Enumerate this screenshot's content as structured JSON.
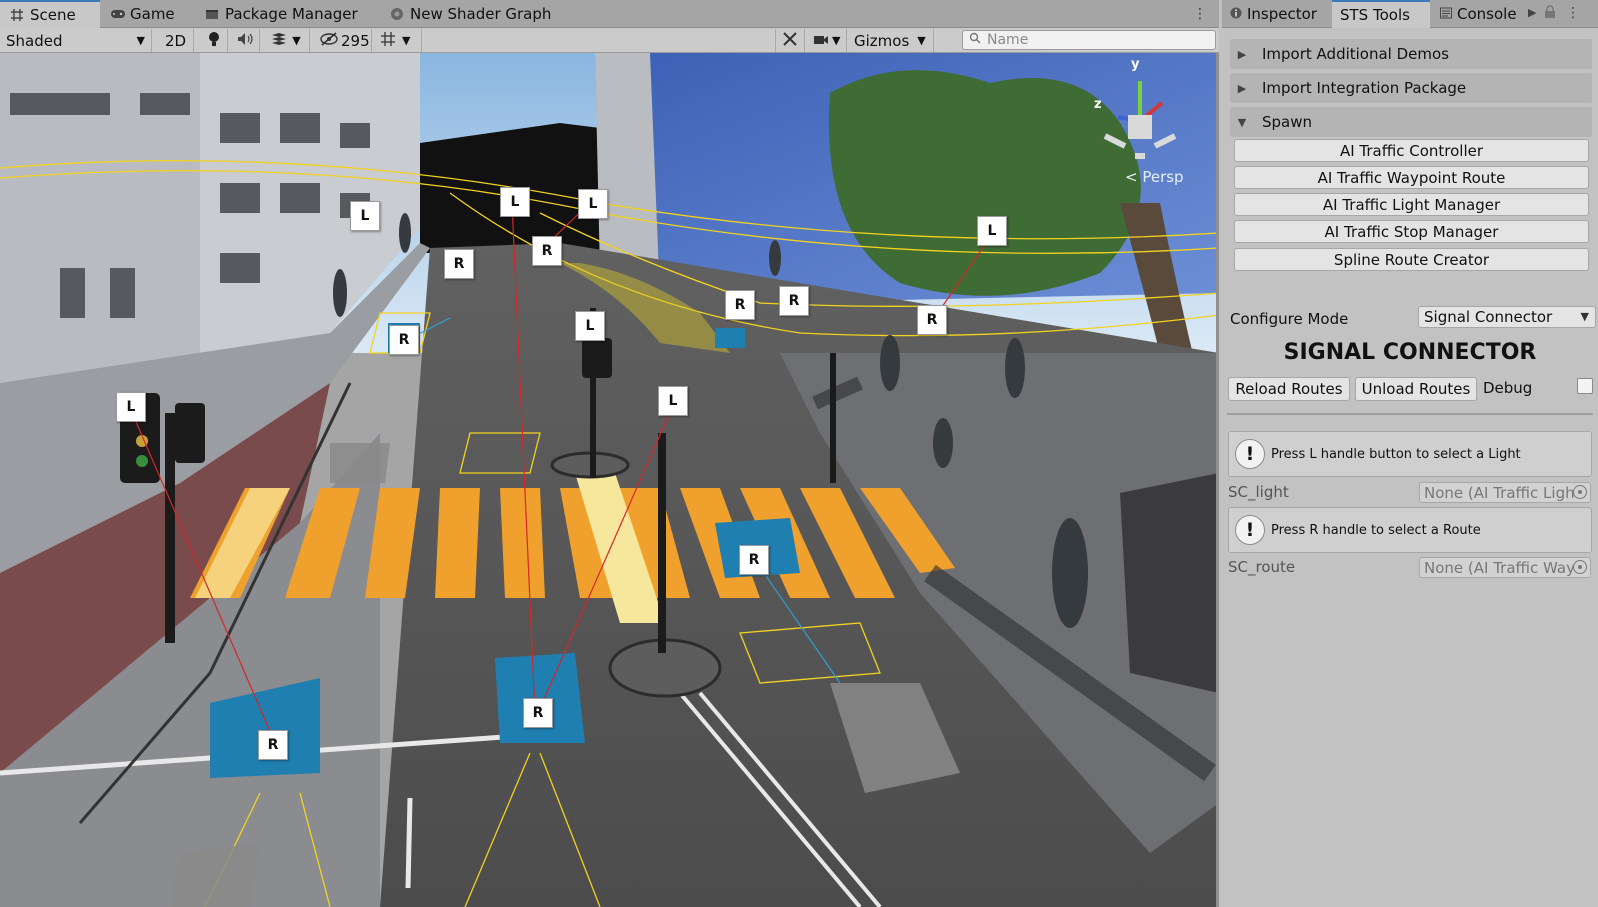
{
  "scene_tabs": [
    {
      "label": "Scene",
      "icon": "grid-icon"
    },
    {
      "label": "Game",
      "icon": "gamepad-icon"
    },
    {
      "label": "Package Manager",
      "icon": "package-icon"
    },
    {
      "label": "New Shader Graph",
      "icon": "shader-graph-icon"
    }
  ],
  "toolbar": {
    "shading_mode": "Shaded",
    "mode_2d": "2D",
    "hidden_count": "295",
    "gizmos": "Gizmos",
    "search_placeholder": "Name"
  },
  "viewport": {
    "persp_label": "< Persp",
    "axis_y": "y",
    "axis_z": "z",
    "handles": [
      {
        "t": "L"
      },
      {
        "t": "L"
      },
      {
        "t": "L"
      },
      {
        "t": "R"
      },
      {
        "t": "R"
      },
      {
        "t": "L"
      },
      {
        "t": "R"
      },
      {
        "t": "L"
      },
      {
        "t": "L"
      },
      {
        "t": "R"
      },
      {
        "t": "R"
      },
      {
        "t": "R"
      },
      {
        "t": "L"
      },
      {
        "t": "L"
      },
      {
        "t": "R"
      },
      {
        "t": "R"
      },
      {
        "t": "R"
      }
    ]
  },
  "right_tabs": [
    {
      "label": "Inspector",
      "icon": "info-icon"
    },
    {
      "label": "STS Tools",
      "icon": ""
    },
    {
      "label": "Console",
      "icon": "console-icon"
    }
  ],
  "sections": {
    "import_demos": "Import Additional Demos",
    "import_integration": "Import Integration Package",
    "spawn": "Spawn"
  },
  "spawn_buttons": [
    "AI Traffic Controller",
    "AI Traffic Waypoint Route",
    "AI Traffic Light Manager",
    "AI Traffic Stop Manager",
    "Spline Route Creator"
  ],
  "configure": {
    "label": "Configure Mode",
    "value": "Signal Connector"
  },
  "signal": {
    "title": "SIGNAL CONNECTOR",
    "reload": "Reload Routes",
    "unload": "Unload Routes",
    "debug": "Debug",
    "light_help": "Press L handle button to select a Light",
    "light_label": "SC_light",
    "light_value": "None (AI Traffic Light",
    "route_help": "Press R handle to select a Route",
    "route_label": "SC_route",
    "route_value": "None (AI Traffic Way"
  },
  "colors": {
    "accent": "#3a79bb",
    "gizmo_yellow": "#f2d21f",
    "route_blue": "#1f7fb0",
    "crosswalk": "#f0a02c"
  }
}
